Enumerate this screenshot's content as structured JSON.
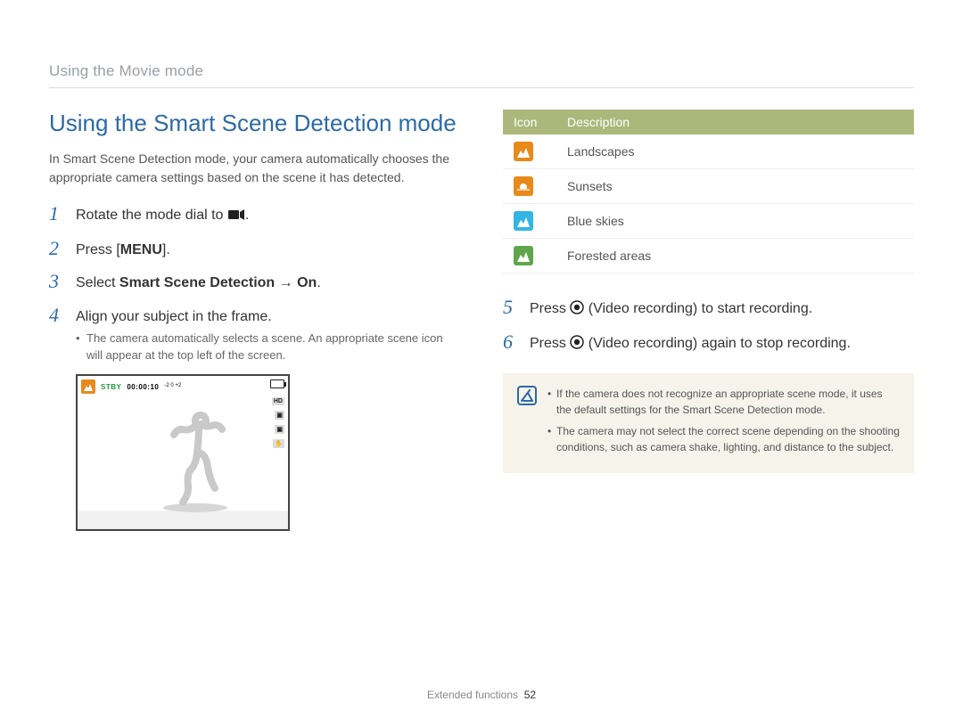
{
  "header": {
    "running": "Using the Movie mode"
  },
  "title": "Using the Smart Scene Detection mode",
  "intro": "In Smart Scene Detection mode, your camera automatically chooses the appropriate camera settings based on the scene it has detected.",
  "steps_left": [
    {
      "n": "1",
      "pre": "Rotate the mode dial to ",
      "icon": "movie-mode-icon",
      "post": "."
    },
    {
      "n": "2",
      "pre": "Press [",
      "strong": "MENU",
      "post": "]."
    },
    {
      "n": "3",
      "pre": "Select ",
      "strong": "Smart Scene Detection",
      "arrow": " → ",
      "strong2": "On",
      "post": "."
    },
    {
      "n": "4",
      "pre": "Align your subject in the frame.",
      "sub": "The camera automatically selects a scene. An appropriate scene icon will appear at the top left of the screen."
    }
  ],
  "camera_preview": {
    "stby": "STBY",
    "time": "00:00:10",
    "ev_scale": "-2  0  +2",
    "right_badges": [
      "HD",
      "▣",
      "▣",
      "✋"
    ]
  },
  "icon_table": {
    "headers": [
      "Icon",
      "Description"
    ],
    "rows": [
      {
        "color": "orange",
        "glyph": "landscape",
        "desc": "Landscapes"
      },
      {
        "color": "orange",
        "glyph": "sunset",
        "desc": "Sunsets"
      },
      {
        "color": "teal",
        "glyph": "landscape",
        "desc": "Blue skies"
      },
      {
        "color": "green",
        "glyph": "landscape",
        "desc": "Forested areas"
      }
    ]
  },
  "steps_right": [
    {
      "n": "5",
      "pre": "Press ",
      "icon": "record-icon",
      "post": " (Video recording) to start recording."
    },
    {
      "n": "6",
      "pre": "Press ",
      "icon": "record-icon",
      "post": " (Video recording) again to stop recording."
    }
  ],
  "notes": [
    "If the camera does not recognize an appropriate scene mode, it uses the default settings for the Smart Scene Detection mode.",
    "The camera may not select the correct scene depending on the shooting conditions, such as camera shake, lighting, and distance to the subject."
  ],
  "footer": {
    "section": "Extended functions",
    "page": "52"
  }
}
